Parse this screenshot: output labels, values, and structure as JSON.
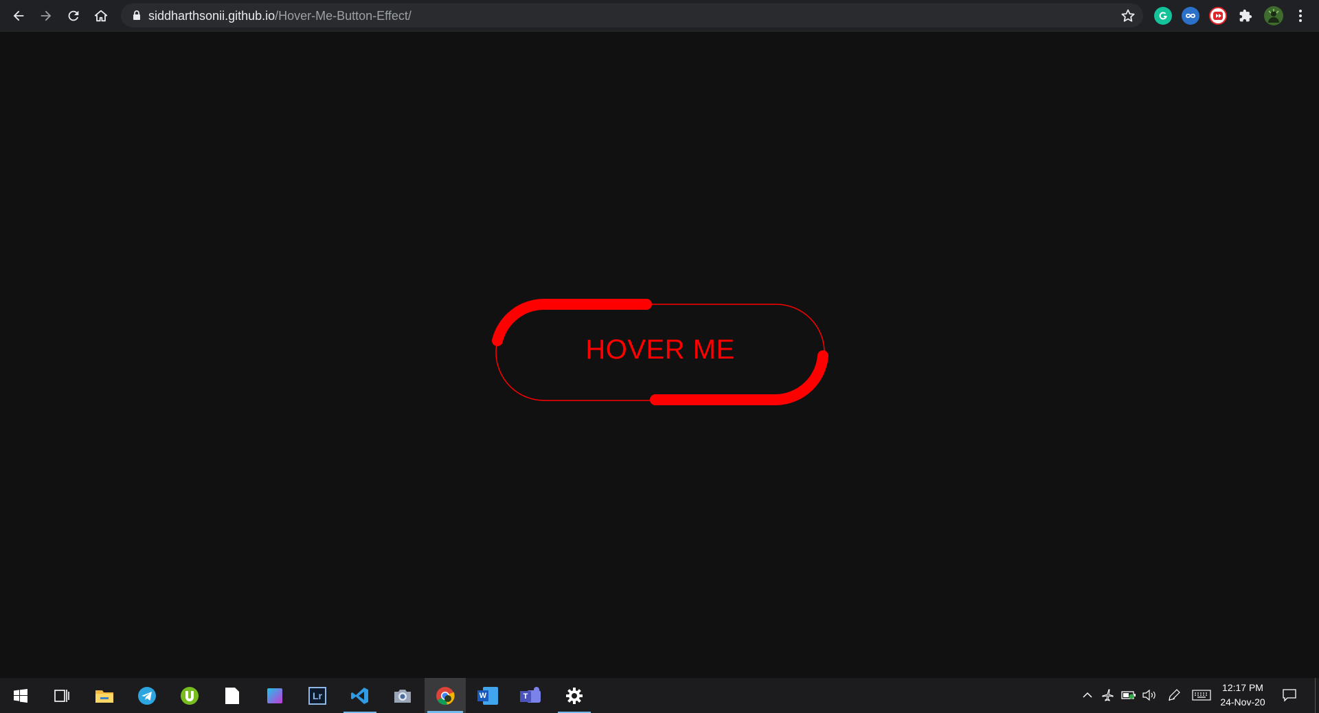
{
  "browser": {
    "url_domain": "siddharthsonii.github.io",
    "url_path": "/Hover-Me-Button-Effect/",
    "nav": {
      "back_icon": "arrow-left-icon",
      "forward_icon": "arrow-right-icon",
      "reload_icon": "reload-icon",
      "home_icon": "home-icon"
    },
    "extensions": [
      {
        "name": "grammarly-icon",
        "color": "#15c39a"
      },
      {
        "name": "infinity-icon",
        "color": "#4a90d9"
      },
      {
        "name": "video-speed-icon",
        "color": "#e0242b"
      },
      {
        "name": "puzzle-icon",
        "color": "#e8eaed"
      },
      {
        "name": "profile-avatar",
        "color": "#3f6b2e"
      },
      {
        "name": "kebab-menu-icon",
        "color": "#e8eaed"
      }
    ]
  },
  "page": {
    "background": "#111112",
    "button_label": "HOVER ME",
    "accent": "#ff0000"
  },
  "taskbar": {
    "apps": [
      {
        "name": "start-icon"
      },
      {
        "name": "task-view-icon"
      },
      {
        "name": "file-explorer-icon"
      },
      {
        "name": "telegram-icon"
      },
      {
        "name": "utorrent-icon"
      },
      {
        "name": "notepad-icon"
      },
      {
        "name": "photo-editor-icon"
      },
      {
        "name": "lightroom-icon"
      },
      {
        "name": "vscode-icon"
      },
      {
        "name": "camera-icon"
      },
      {
        "name": "chrome-icon"
      },
      {
        "name": "word-icon"
      },
      {
        "name": "teams-icon"
      },
      {
        "name": "settings-icon"
      }
    ],
    "lightroom_label": "Lr",
    "word_label": "W",
    "teams_label": "T",
    "clock_time": "12:17 PM",
    "clock_date": "24-Nov-20"
  }
}
